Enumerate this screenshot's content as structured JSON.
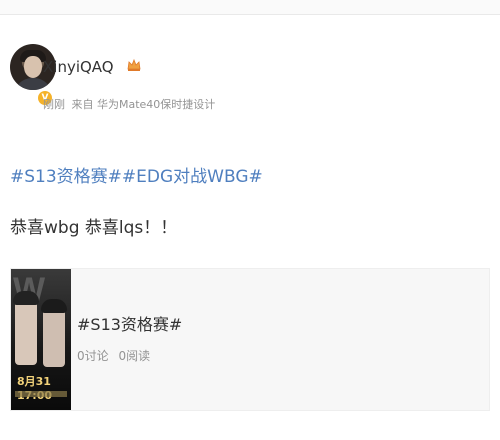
{
  "post": {
    "author": {
      "name": "XinyiQAQ",
      "badge_icon": "crown-icon",
      "verified_icon": "verified-badge-icon"
    },
    "meta": {
      "time": "刚刚",
      "source": "来自 华为Mate40保时捷设计"
    },
    "topics": [
      "#S13资格赛#",
      "#EDG对战WBG#"
    ],
    "text": "恭喜wbg 恭喜lqs！！"
  },
  "card": {
    "title": "#S13资格赛#",
    "discussions": "0讨论",
    "reads": "0阅读",
    "thumbnail_date": "8月31 17:00"
  },
  "colors": {
    "link": "#4f7fbf",
    "text": "#333333",
    "muted": "#939393",
    "card_bg": "#f7f7f7"
  }
}
